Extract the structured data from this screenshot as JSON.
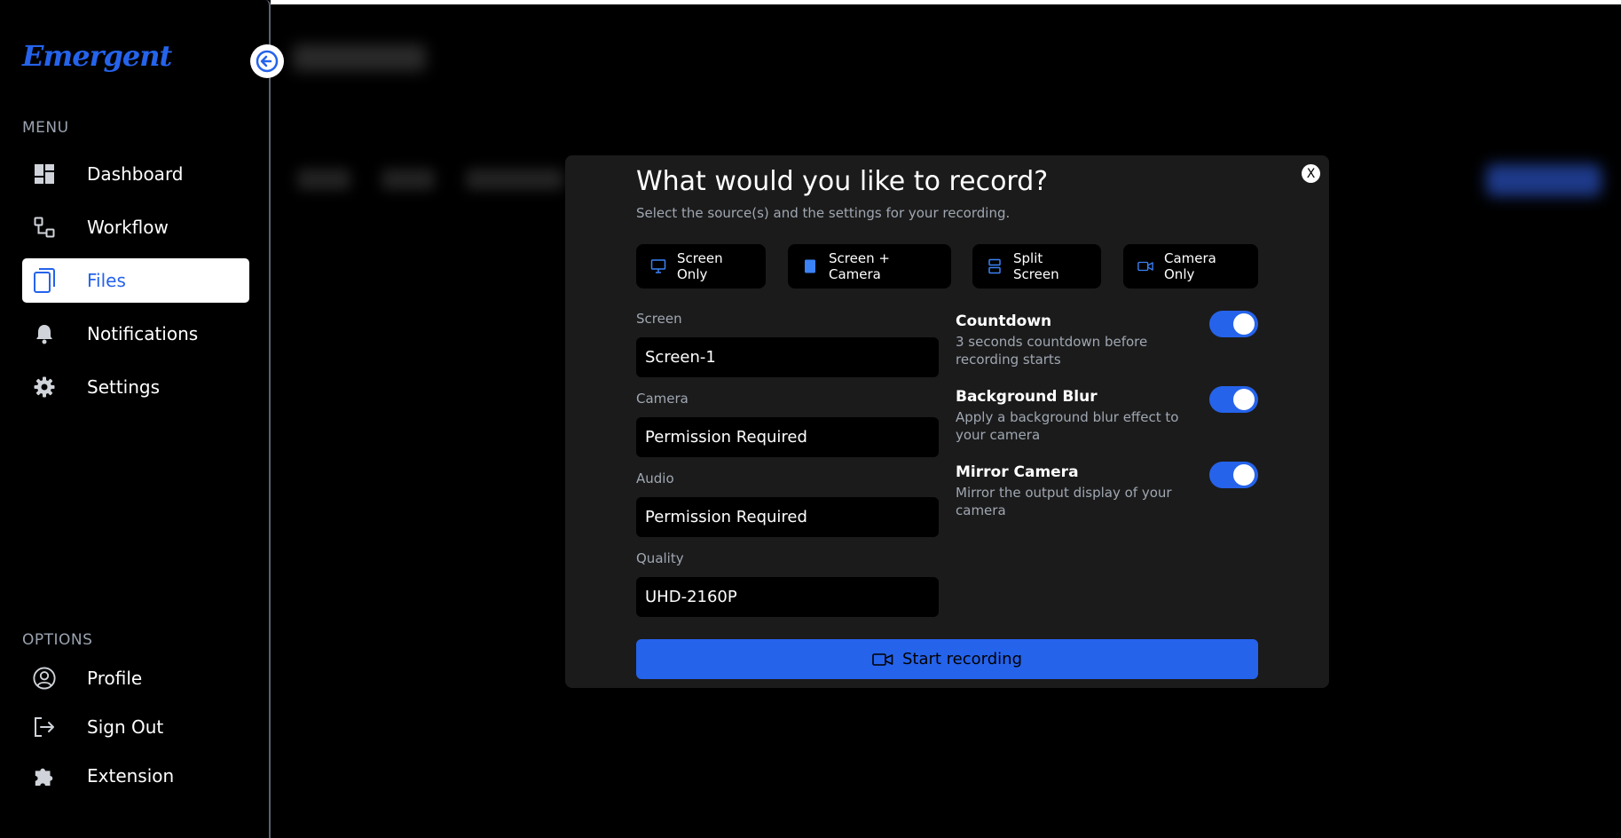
{
  "app": {
    "logo": "Emergent"
  },
  "sidebar": {
    "menu_label": "MENU",
    "menu_items": [
      {
        "label": "Dashboard",
        "icon": "dashboard-icon",
        "active": false
      },
      {
        "label": "Workflow",
        "icon": "workflow-icon",
        "active": false
      },
      {
        "label": "Files",
        "icon": "files-icon",
        "active": true
      },
      {
        "label": "Notifications",
        "icon": "bell-icon",
        "active": false
      },
      {
        "label": "Settings",
        "icon": "gear-icon",
        "active": false
      }
    ],
    "options_label": "OPTIONS",
    "option_items": [
      {
        "label": "Profile",
        "icon": "user-circle-icon"
      },
      {
        "label": "Sign Out",
        "icon": "sign-out-icon"
      },
      {
        "label": "Extension",
        "icon": "puzzle-icon"
      }
    ]
  },
  "modal": {
    "close_label": "X",
    "title": "What would you like to record?",
    "subtitle": "Select the source(s) and the settings for your recording.",
    "sources": [
      {
        "label": "Screen Only",
        "icon": "monitor-icon"
      },
      {
        "label": "Screen + Camera",
        "icon": "screen-camera-icon"
      },
      {
        "label": "Split Screen",
        "icon": "split-screen-icon"
      },
      {
        "label": "Camera Only",
        "icon": "video-camera-icon"
      }
    ],
    "fields": {
      "screen": {
        "label": "Screen",
        "value": "Screen-1"
      },
      "camera": {
        "label": "Camera",
        "value": "Permission Required"
      },
      "audio": {
        "label": "Audio",
        "value": "Permission Required"
      },
      "quality": {
        "label": "Quality",
        "value": "UHD-2160P"
      }
    },
    "options": [
      {
        "title": "Countdown",
        "description": "3 seconds countdown before recording starts",
        "enabled": true
      },
      {
        "title": "Background Blur",
        "description": "Apply a background blur effect to your camera",
        "enabled": true
      },
      {
        "title": "Mirror Camera",
        "description": "Mirror the output display of your camera",
        "enabled": true
      }
    ],
    "start_label": "Start recording"
  },
  "colors": {
    "accent": "#2563eb",
    "modal_bg": "#1b1b1b",
    "field_bg": "#000000",
    "muted_text": "#a0a7b2"
  }
}
